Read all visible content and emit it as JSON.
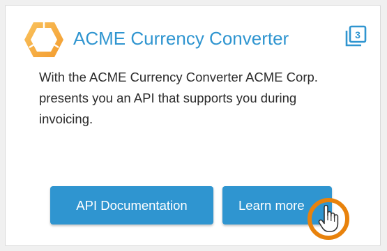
{
  "card": {
    "title": "ACME Currency Converter",
    "description": "With the ACME Currency Converter ACME Corp. presents you an API that supports you during invoicing.",
    "badge_number": "3",
    "buttons": {
      "api_documentation": "API Documentation",
      "learn_more": "Learn more"
    }
  },
  "colors": {
    "accent": "#2f95d0",
    "logo": "#f6b04a",
    "cursor_ring": "#e8820c"
  },
  "icons": {
    "logo": "hexagon-ring-logo",
    "badge": "stacked-pages-3-icon",
    "cursor": "hand-pointer-icon"
  }
}
